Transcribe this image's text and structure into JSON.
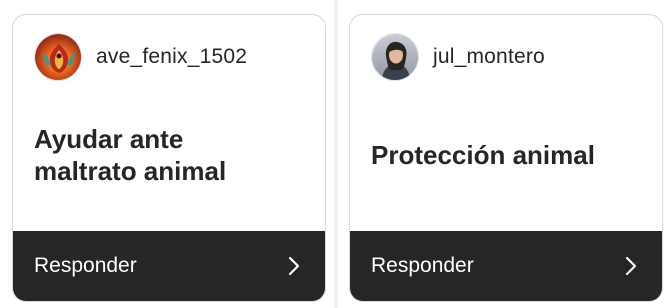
{
  "cards": [
    {
      "username": "ave_fenix_1502",
      "avatar_icon": "phoenix-avatar-icon",
      "question": "Ayudar ante maltrato animal",
      "question_lines": [
        "Ayudar ante",
        "maltrato animal"
      ],
      "reply_label": "Responder",
      "reply_icon": "chevron-right-icon"
    },
    {
      "username": "jul_montero",
      "avatar_icon": "person-photo-avatar-icon",
      "question": "Protección animal",
      "reply_label": "Responder",
      "reply_icon": "chevron-right-icon"
    }
  ],
  "colors": {
    "text_dark": "#262626",
    "reply_bar_bg": "#262626",
    "reply_text": "#ffffff",
    "card_border": "#d9d9d9"
  }
}
